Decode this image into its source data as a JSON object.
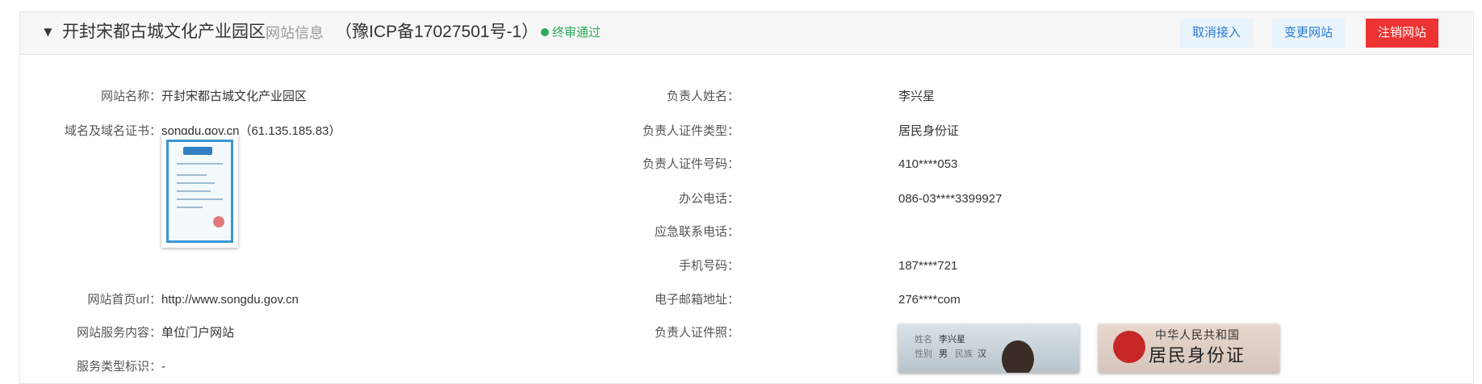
{
  "header": {
    "toggle_icon": "▼",
    "site_name": "开封宋都古城文化产业园区",
    "site_info_label": "网站信息",
    "icp": "（豫ICP备17027501号-1）",
    "status": "终审通过",
    "status_color": "#2eaa5c",
    "buttons": {
      "cancel_access": "取消接入",
      "change_site": "变更网站",
      "cancel_site": "注销网站"
    }
  },
  "left": {
    "site_name_label": "网站名称：",
    "site_name_value": "开封宋都古城文化产业园区",
    "domain_label": "域名及域名证书：",
    "domain_value": "songdu.gov.cn（61.135.185.83）",
    "homepage_label": "网站首页url：",
    "homepage_value": "http://www.songdu.gov.cn",
    "service_label": "网站服务内容：",
    "service_value": "单位门户网站",
    "service_type_label": "服务类型标识：",
    "service_type_value": "-"
  },
  "right": {
    "name_label": "负责人姓名：",
    "name_value": "李兴星",
    "id_type_label": "负责人证件类型：",
    "id_type_value": "居民身份证",
    "id_no_label": "负责人证件号码：",
    "id_no_value": "410****053",
    "office_phone_label": "办公电话：",
    "office_phone_value": "086-03****3399927",
    "emergency_label": "应急联系电话：",
    "emergency_value": "",
    "mobile_label": "手机号码：",
    "mobile_value": "187****721",
    "email_label": "电子邮箱地址：",
    "email_value": "276****com",
    "id_photo_label": "负责人证件照："
  },
  "id_card": {
    "back_title": "中华人民共和国",
    "back_big": "居民身份证",
    "front_name_label": "姓名",
    "front_name": "李兴星",
    "front_sex_label": "性别",
    "front_sex": "男",
    "front_ethnic_label": "民族",
    "front_ethnic": "汉"
  }
}
